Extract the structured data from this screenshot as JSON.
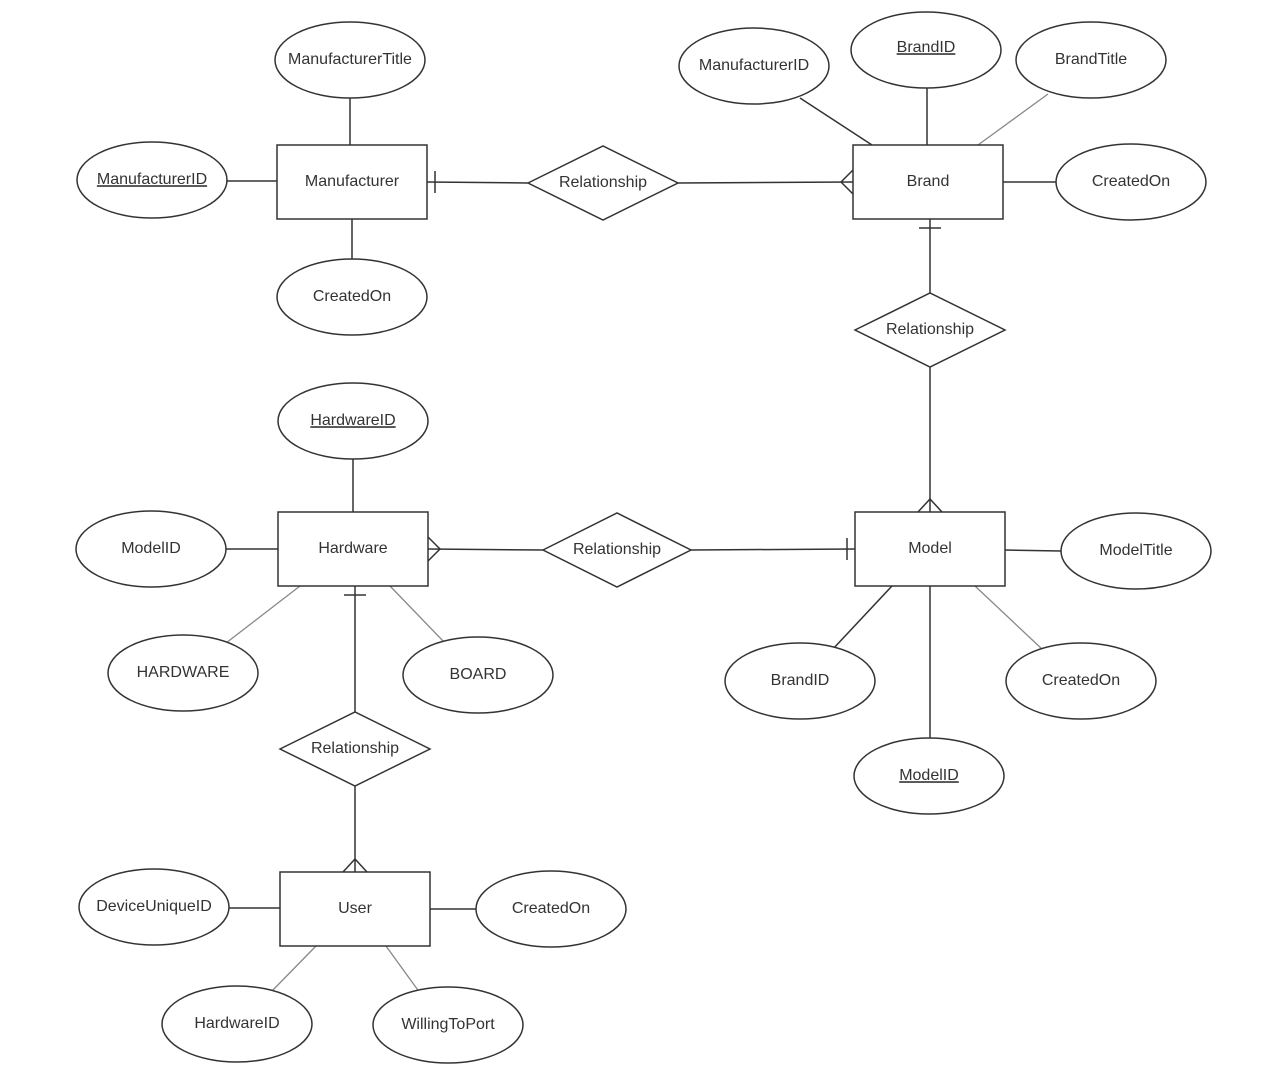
{
  "diagram": {
    "entities": {
      "manufacturer": "Manufacturer",
      "brand": "Brand",
      "model": "Model",
      "hardware": "Hardware",
      "user": "User"
    },
    "relationships": {
      "manufacturer_brand": "Relationship",
      "brand_model": "Relationship",
      "hardware_model": "Relationship",
      "hardware_user": "Relationship"
    },
    "attributes": {
      "manufacturer": {
        "title": "ManufacturerTitle",
        "id": "ManufacturerID",
        "created": "CreatedOn"
      },
      "brand": {
        "manufacturer_id": "ManufacturerID",
        "id": "BrandID",
        "title": "BrandTitle",
        "created": "CreatedOn"
      },
      "model": {
        "title": "ModelTitle",
        "brand_id": "BrandID",
        "id": "ModelID",
        "created": "CreatedOn"
      },
      "hardware": {
        "id": "HardwareID",
        "model_id": "ModelID",
        "hardware": "HARDWARE",
        "board": "BOARD"
      },
      "user": {
        "device_id": "DeviceUniqueID",
        "created": "CreatedOn",
        "hardware_id": "HardwareID",
        "willing": "WillingToPort"
      }
    },
    "primary_keys": [
      "ManufacturerID",
      "BrandID",
      "ModelID",
      "HardwareID"
    ]
  }
}
